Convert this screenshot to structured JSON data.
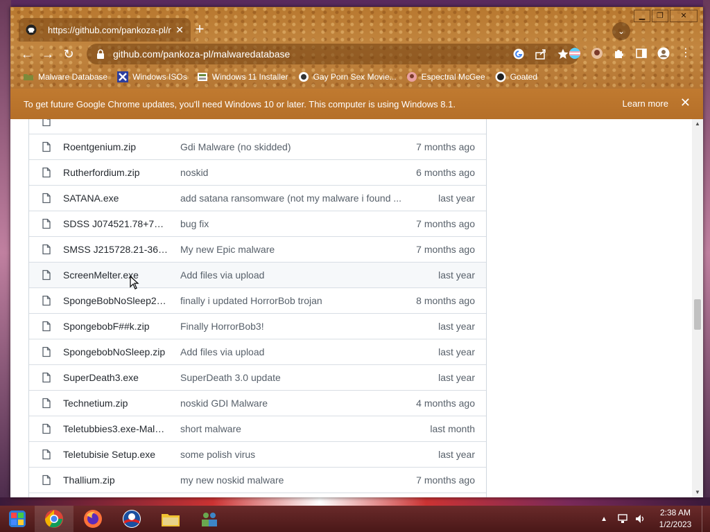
{
  "browser": {
    "tab_title": "https://github.com/pankoza-pl/m",
    "new_tab_label": "+",
    "url_host": "github.com",
    "url_path": "/pankoza-pl/malwaredatabase",
    "window_controls": {
      "minimize": "▁",
      "maximize": "❐",
      "close": "✕"
    }
  },
  "bookmarks": [
    {
      "label": "Malware Database",
      "icon": "folder-icon",
      "color": "#6aa84f"
    },
    {
      "label": "Windows ISOs",
      "icon": "x-logo-icon",
      "color": "#2c3e9e"
    },
    {
      "label": "Windows 11 Installer",
      "icon": "installer-icon",
      "color": "#ffffff"
    },
    {
      "label": "Gay Porn Sex Movie...",
      "icon": "site-icon",
      "color": "#ffffff"
    },
    {
      "label": "Espectral McGee",
      "icon": "avatar-icon",
      "color": "#e8a0a0"
    },
    {
      "label": "Goated",
      "icon": "github-icon",
      "color": "#222222"
    }
  ],
  "infobar": {
    "message": "To get future Google Chrome updates, you'll need Windows 10 or later. This computer is using Windows 8.1.",
    "learn_more": "Learn more",
    "close": "✕"
  },
  "files": [
    {
      "name": "",
      "message": "",
      "date": ""
    },
    {
      "name": "Roentgenium.zip",
      "message": "Gdi Malware (no skidded)",
      "date": "7 months ago"
    },
    {
      "name": "Rutherfordium.zip",
      "message": "noskid",
      "date": "6 months ago"
    },
    {
      "name": "SATANA.exe",
      "message": "add satana ransomware (not my malware i found ...",
      "date": "last year"
    },
    {
      "name": "SDSS J074521.78+7343...",
      "message": "bug fix",
      "date": "7 months ago"
    },
    {
      "name": "SMSS J215728.21-36021...",
      "message": "My new Epic malware",
      "date": "7 months ago"
    },
    {
      "name": "ScreenMelter.exe",
      "message": "Add files via upload",
      "date": "last year"
    },
    {
      "name": "SpongeBobNoSleep2 (...",
      "message": "finally i updated HorrorBob trojan",
      "date": "8 months ago"
    },
    {
      "name": "SpongebobF##k.zip",
      "message": "Finally HorrorBob3!",
      "date": "last year"
    },
    {
      "name": "SpongebobNoSleep.zip",
      "message": "Add files via upload",
      "date": "last year"
    },
    {
      "name": "SuperDeath3.exe",
      "message": "SuperDeath 3.0 update",
      "date": "last year"
    },
    {
      "name": "Technetium.zip",
      "message": "noskid GDI Malware",
      "date": "4 months ago"
    },
    {
      "name": "Teletubbies3.exe-Malwa...",
      "message": "short malware",
      "date": "last month"
    },
    {
      "name": "Teletubisie Setup.exe",
      "message": "some polish virus",
      "date": "last year"
    },
    {
      "name": "Thallium.zip",
      "message": "my new noskid malware",
      "date": "7 months ago"
    },
    {
      "name": "",
      "message": "",
      "date": ""
    }
  ],
  "taskbar": {
    "apps": [
      "start-orb-icon",
      "chrome-icon",
      "firefox-icon",
      "obama-icon",
      "file-explorer-icon",
      "network-users-icon"
    ],
    "time": "2:38 AM",
    "date": "1/2/2023"
  },
  "colors": {
    "chrome_frame": "#b8782f",
    "infobar": "#bb752c",
    "row_border": "#d8dee4",
    "muted_text": "#57606a",
    "taskbar": "#5a2020"
  }
}
